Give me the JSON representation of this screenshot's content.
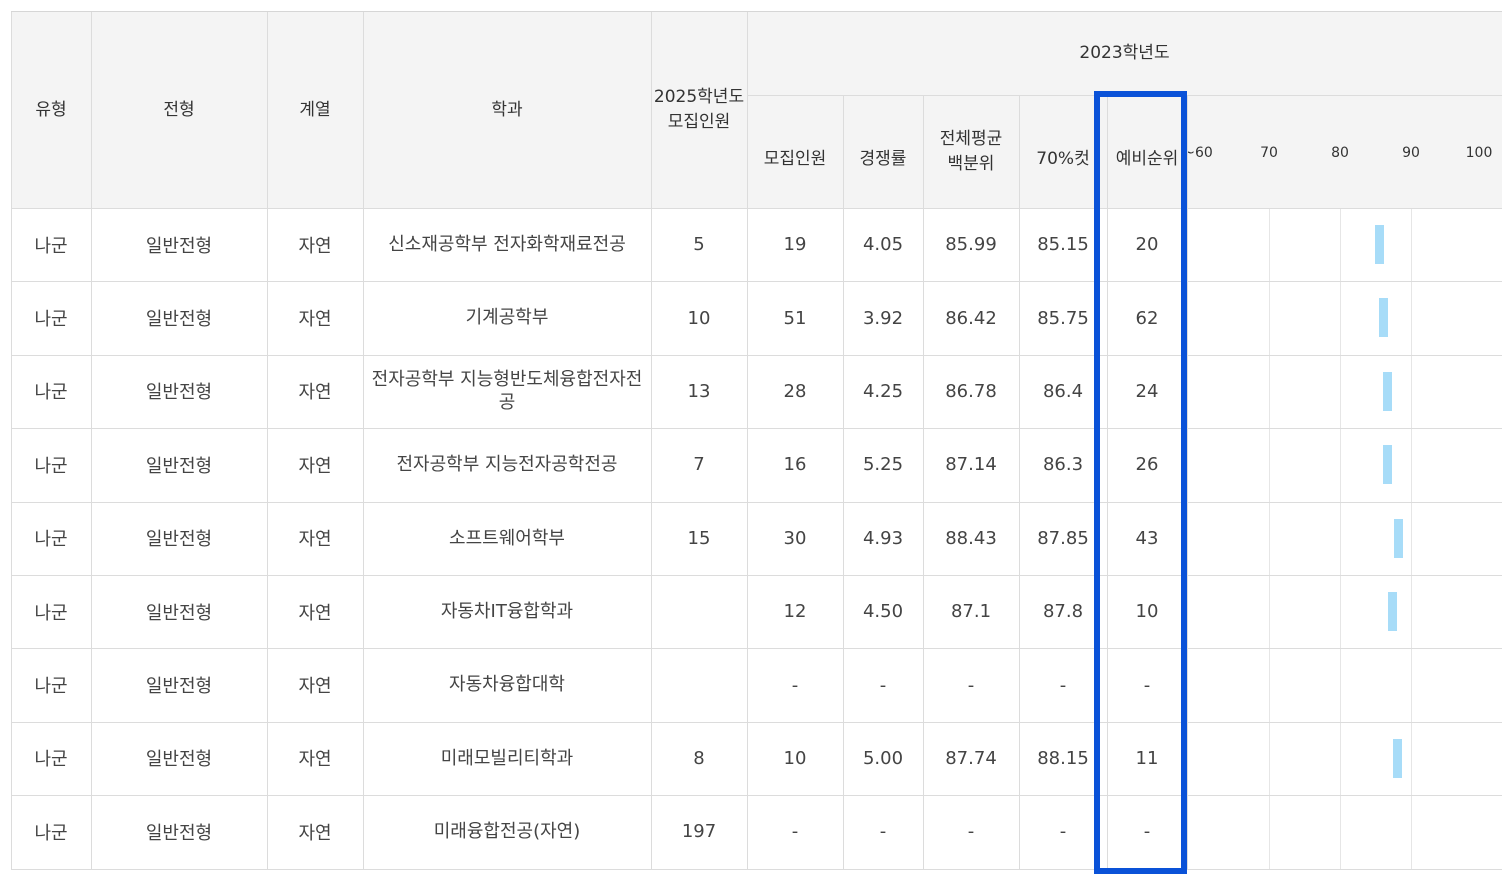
{
  "table": {
    "headers": {
      "type": "유형",
      "admission": "전형",
      "track": "계열",
      "dept": "학과",
      "quota2025": "2025학년도\n모집인원",
      "year2023": "2023학년도",
      "quota": "모집인원",
      "competition": "경쟁률",
      "avg_percentile": "전체평균\n백분위",
      "cut70": "70%컷",
      "waitlist_rank": "예비순위"
    },
    "scale_labels": [
      "~60",
      "70",
      "80",
      "90",
      "100"
    ],
    "rows": [
      {
        "type": "나군",
        "admission": "일반전형",
        "track": "자연",
        "dept": "신소재공학부 전자화학재료전공",
        "quota2025": "5",
        "quota": "19",
        "competition": "4.05",
        "avg_percentile": "85.99",
        "cut70": "85.15",
        "waitlist_rank": "20",
        "bar_range": [
          85.15,
          85.99
        ]
      },
      {
        "type": "나군",
        "admission": "일반전형",
        "track": "자연",
        "dept": "기계공학부",
        "quota2025": "10",
        "quota": "51",
        "competition": "3.92",
        "avg_percentile": "86.42",
        "cut70": "85.75",
        "waitlist_rank": "62",
        "bar_range": [
          85.75,
          86.42
        ]
      },
      {
        "type": "나군",
        "admission": "일반전형",
        "track": "자연",
        "dept": "전자공학부 지능형반도체융합전자전공",
        "quota2025": "13",
        "quota": "28",
        "competition": "4.25",
        "avg_percentile": "86.78",
        "cut70": "86.4",
        "waitlist_rank": "24",
        "bar_range": [
          86.4,
          86.78
        ]
      },
      {
        "type": "나군",
        "admission": "일반전형",
        "track": "자연",
        "dept": "전자공학부 지능전자공학전공",
        "quota2025": "7",
        "quota": "16",
        "competition": "5.25",
        "avg_percentile": "87.14",
        "cut70": "86.3",
        "waitlist_rank": "26",
        "bar_range": [
          86.3,
          87.14
        ]
      },
      {
        "type": "나군",
        "admission": "일반전형",
        "track": "자연",
        "dept": "소프트웨어학부",
        "quota2025": "15",
        "quota": "30",
        "competition": "4.93",
        "avg_percentile": "88.43",
        "cut70": "87.85",
        "waitlist_rank": "43",
        "bar_range": [
          87.85,
          88.43
        ]
      },
      {
        "type": "나군",
        "admission": "일반전형",
        "track": "자연",
        "dept": "자동차IT융합학과",
        "quota2025": "",
        "quota": "12",
        "competition": "4.50",
        "avg_percentile": "87.1",
        "cut70": "87.8",
        "waitlist_rank": "10",
        "bar_range": [
          87.1,
          87.8
        ]
      },
      {
        "type": "나군",
        "admission": "일반전형",
        "track": "자연",
        "dept": "자동차융합대학",
        "quota2025": "",
        "quota": "-",
        "competition": "-",
        "avg_percentile": "-",
        "cut70": "-",
        "waitlist_rank": "-",
        "bar_range": null
      },
      {
        "type": "나군",
        "admission": "일반전형",
        "track": "자연",
        "dept": "미래모빌리티학과",
        "quota2025": "8",
        "quota": "10",
        "competition": "5.00",
        "avg_percentile": "87.74",
        "cut70": "88.15",
        "waitlist_rank": "11",
        "bar_range": [
          87.74,
          88.15
        ]
      },
      {
        "type": "나군",
        "admission": "일반전형",
        "track": "자연",
        "dept": "미래융합전공(자연)",
        "quota2025": "197",
        "quota": "-",
        "competition": "-",
        "avg_percentile": "-",
        "cut70": "-",
        "waitlist_rank": "-",
        "bar_range": null
      }
    ]
  },
  "colors": {
    "bar": "#a7dcf8",
    "highlight": "#0a52d8",
    "header_bg": "#f4f4f4"
  }
}
